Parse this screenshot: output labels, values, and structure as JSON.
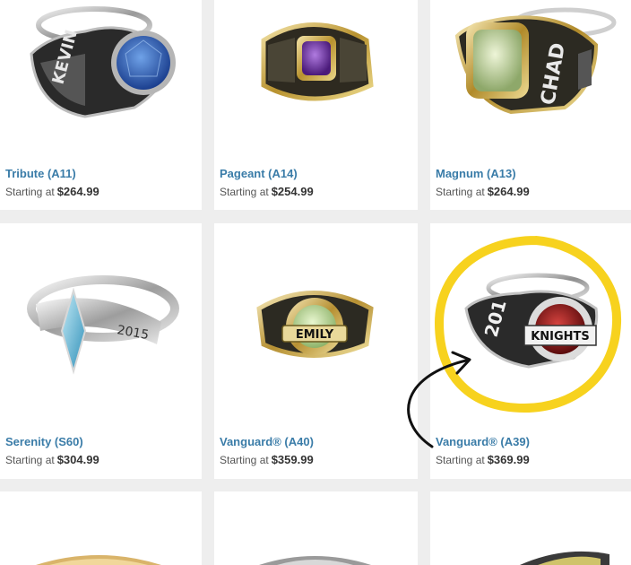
{
  "colors": {
    "link": "#3a7ca8",
    "highlight": "#f7d21e",
    "background": "#eeeeee"
  },
  "products": [
    {
      "name": "Tribute (A11)",
      "prefix": "Starting at",
      "price": "$264.99",
      "stone": "blue-oval-stone",
      "engraving": "KEVIN"
    },
    {
      "name": "Pageant (A14)",
      "prefix": "Starting at",
      "price": "$254.99",
      "stone": "purple-cushion-stone",
      "engraving": ""
    },
    {
      "name": "Magnum (A13)",
      "prefix": "Starting at",
      "price": "$264.99",
      "stone": "green-square-stone",
      "engraving": "CHAD"
    },
    {
      "name": "Serenity (S60)",
      "prefix": "Starting at",
      "price": "$304.99",
      "stone": "blue-marquise-stone",
      "engraving": "2015"
    },
    {
      "name": "Vanguard® (A40)",
      "prefix": "Starting at",
      "price": "$359.99",
      "stone": "green-cushion-stone",
      "engraving": "EMILY"
    },
    {
      "name": "Vanguard® (A39)",
      "prefix": "Starting at",
      "price": "$369.99",
      "stone": "red-oval-stone",
      "engraving": "KNIGHTS"
    }
  ],
  "annotation": {
    "type": "yellow-circle-and-arrow",
    "target": "Vanguard® (A39)"
  }
}
